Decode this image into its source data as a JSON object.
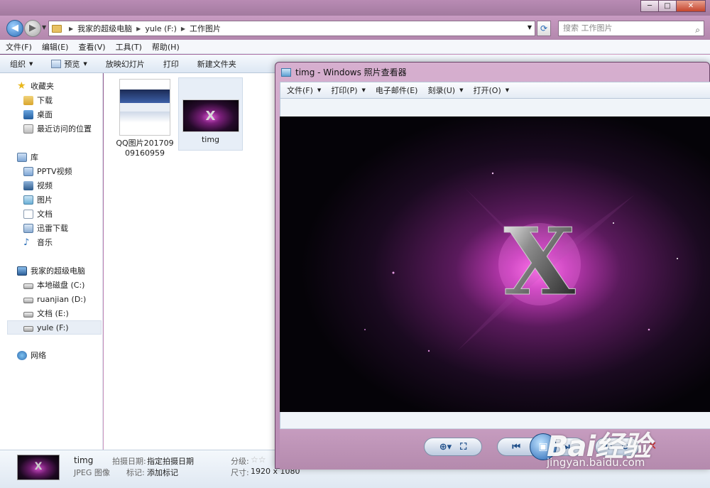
{
  "explorer": {
    "window_controls": {
      "minimize": "─",
      "maximize": "□",
      "close": "✕"
    },
    "breadcrumb": [
      "我家的超级电脑",
      "yule (F:)",
      "工作图片"
    ],
    "search_placeholder": "搜索 工作图片",
    "menu": [
      "文件(F)",
      "编辑(E)",
      "查看(V)",
      "工具(T)",
      "帮助(H)"
    ],
    "toolbar": {
      "organize": "组织",
      "preview": "预览",
      "slideshow": "放映幻灯片",
      "print": "打印",
      "new_folder": "新建文件夹"
    },
    "nav": {
      "favorites": "收藏夹",
      "download": "下载",
      "desktop": "桌面",
      "recent": "最近访问的位置",
      "libraries": "库",
      "pptv": "PPTV视频",
      "video": "视频",
      "pictures": "图片",
      "documents": "文档",
      "thunder": "迅雷下载",
      "music": "音乐",
      "computer": "我家的超级电脑",
      "drive_c": "本地磁盘 (C:)",
      "drive_d": "ruanjian (D:)",
      "drive_e": "文档 (E:)",
      "drive_f": "yule (F:)",
      "network": "网络"
    },
    "files": [
      {
        "name": "QQ图片20170909160959"
      },
      {
        "name": "timg"
      }
    ],
    "status": {
      "name": "timg",
      "type": "JPEG 图像",
      "date_label": "拍摄日期:",
      "date_value": "指定拍摄日期",
      "tag_label": "标记:",
      "tag_value": "添加标记",
      "rating_label": "分级:",
      "size_label": "尺寸:",
      "size_value": "1920 x 1080"
    }
  },
  "viewer": {
    "title": "timg - Windows 照片查看器",
    "menu": [
      "文件(F)",
      "打印(P)",
      "电子邮件(E)",
      "刻录(U)",
      "打开(O)"
    ],
    "image_letter": "X"
  },
  "watermark": {
    "logo": "Bai经验",
    "url": "jingyan.baidu.com"
  }
}
